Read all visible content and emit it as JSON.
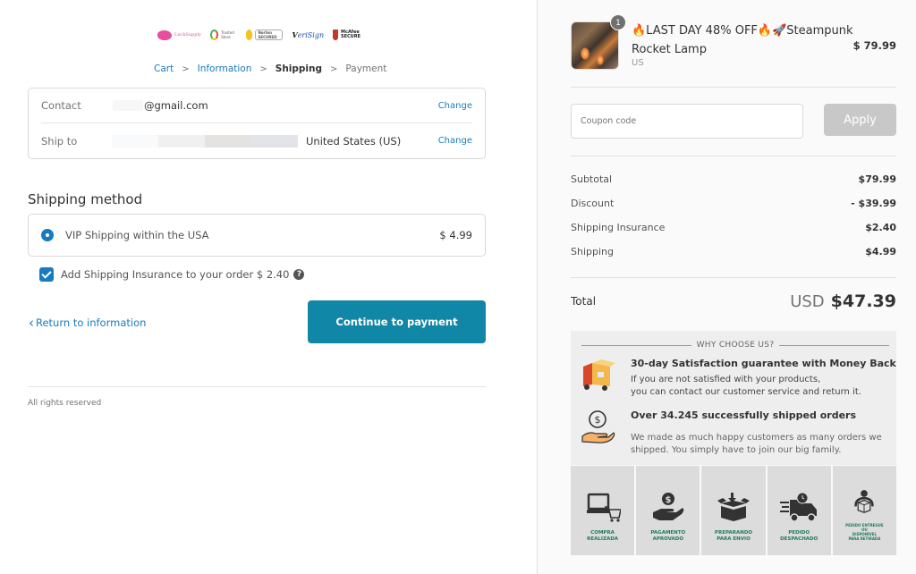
{
  "trust_badges": [
    {
      "name": "Lucky Supply",
      "label": "LuckSupply"
    },
    {
      "name": "Google Trusted Store",
      "label": "Trusted Store"
    },
    {
      "name": "Norton Secured",
      "label": "Norton SECURED"
    },
    {
      "name": "VeriSign",
      "label_prefix": "V",
      "label_rest": "eriSign"
    },
    {
      "name": "McAfee Secure",
      "label": "McAfee SECURE"
    }
  ],
  "breadcrumb": {
    "items": [
      "Cart",
      "Information",
      "Shipping",
      "Payment"
    ],
    "separator": ">",
    "current_index": 2
  },
  "review": {
    "contact_label": "Contact",
    "contact_value": "@gmail.com",
    "ship_to_label": "Ship to",
    "ship_to_value": "United States (US)",
    "change_label": "Change"
  },
  "shipping": {
    "section_title": "Shipping method",
    "method_name": "VIP Shipping within the USA",
    "method_price": "$ 4.99",
    "selected": true,
    "insurance_label": "Add Shipping Insurance to your order $ 2.40",
    "insurance_checked": true,
    "help_icon": "?"
  },
  "actions": {
    "return_label": "Return to information",
    "return_chevron": "‹",
    "continue_label": "Continue to payment"
  },
  "footer": {
    "text": "All rights reserved"
  },
  "order": {
    "product": {
      "title": "🔥LAST DAY 48% OFF🔥🚀Steampunk Rocket Lamp",
      "variant": "US",
      "price": "$ 79.99",
      "quantity": "1"
    },
    "coupon": {
      "placeholder": "Coupon code",
      "value": "",
      "apply_label": "Apply"
    },
    "summary": [
      {
        "label": "Subtotal",
        "value": "$79.99"
      },
      {
        "label": "Discount",
        "value": "- $39.99"
      },
      {
        "label": "Shipping Insurance",
        "value": "$2.40"
      },
      {
        "label": "Shipping",
        "value": "$4.99"
      }
    ],
    "total": {
      "label": "Total",
      "currency": "USD",
      "amount": "$47.39"
    }
  },
  "why_choose": {
    "heading": "WHY CHOOSE US?",
    "items": [
      {
        "icon": "delivery-box-icon",
        "title": "30-day Satisfaction guarantee with Money Back",
        "desc_line1": "If you are not satisfied with your products,",
        "desc_line2": "you can contact our customer service and return it."
      },
      {
        "icon": "money-hand-icon",
        "title": "Over 34.245 successfully shipped orders",
        "desc_line1": "We made as much happy customers as many orders we",
        "desc_line2": "shipped. You simply have to join our big family."
      }
    ]
  },
  "order_steps": [
    {
      "icon": "laptop-cart-icon",
      "line1": "COMPRA",
      "line2": "REALIZADA"
    },
    {
      "icon": "payment-hand-icon",
      "line1": "PAGAMENTO",
      "line2": "APROVADO"
    },
    {
      "icon": "packing-box-icon",
      "line1": "PREPARANDO",
      "line2": "PARA ENVIO"
    },
    {
      "icon": "delivery-truck-icon",
      "line1": "PEDIDO",
      "line2": "DESPACHADO"
    },
    {
      "icon": "person-package-icon",
      "line1": "PEDIDO ENTREGUE",
      "line2": "OU",
      "line3": "DISPONÍVEL",
      "line4": "PARA RETIRADA"
    }
  ],
  "colors": {
    "accent": "#197bbd",
    "primary_button": "#1187a8",
    "apply_disabled": "#c8c8c8",
    "step_caption": "#1f7a5a"
  }
}
